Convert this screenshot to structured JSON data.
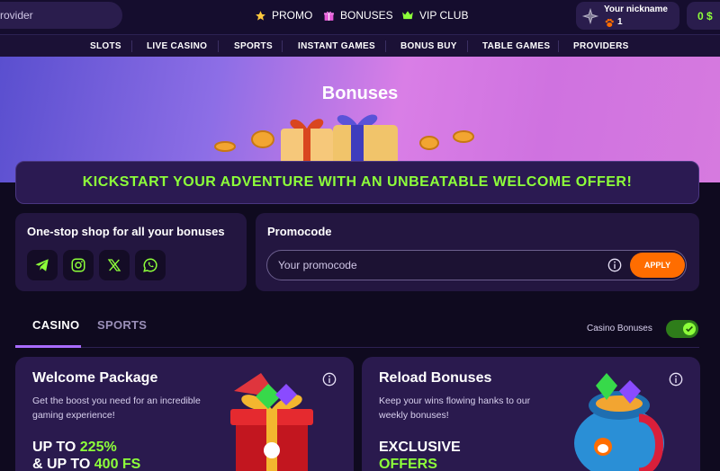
{
  "header": {
    "search_placeholder": "rovider",
    "nav": [
      {
        "label": "PROMO",
        "icon": "star-icon"
      },
      {
        "label": "BONUSES",
        "icon": "gift-icon"
      },
      {
        "label": "VIP CLUB",
        "icon": "crown-icon"
      }
    ],
    "user": {
      "nickname": "Your nickname",
      "level": "1"
    },
    "balance": "0 $"
  },
  "categories": [
    "SLOTS",
    "LIVE CASINO",
    "SPORTS",
    "INSTANT GAMES",
    "BONUS BUY",
    "TABLE GAMES",
    "PROVIDERS"
  ],
  "hero": {
    "title": "Bonuses"
  },
  "offer_banner": "KICKSTART YOUR ADVENTURE WITH AN UNBEATABLE WELCOME OFFER!",
  "shop": {
    "title": "One-stop shop for all your bonuses",
    "socials": [
      "telegram-icon",
      "instagram-icon",
      "x-icon",
      "whatsapp-icon"
    ]
  },
  "promo": {
    "title": "Promocode",
    "placeholder": "Your promocode",
    "apply_label": "APPLY"
  },
  "tabs": {
    "casino": "CASINO",
    "sports": "SPORTS"
  },
  "toggle": {
    "label": "Casino Bonuses",
    "on": true
  },
  "cards": [
    {
      "title": "Welcome Package",
      "desc": "Get the boost you need for an incredible gaming experience!",
      "line1_prefix": "UP TO ",
      "line1_value": "225%",
      "line2_prefix": "& UP TO ",
      "line2_value": "400 FS"
    },
    {
      "title": "Reload Bonuses",
      "desc": "Keep your wins flowing hanks to our weekly bonuses!",
      "line1_prefix": "EXCLUSIVE",
      "line2_value": "OFFERS"
    }
  ],
  "colors": {
    "accent_green": "#8dff3a",
    "apply_orange": "#ff6d00",
    "tab_underline": "#a86bff",
    "bg": "#0f0a1f"
  }
}
